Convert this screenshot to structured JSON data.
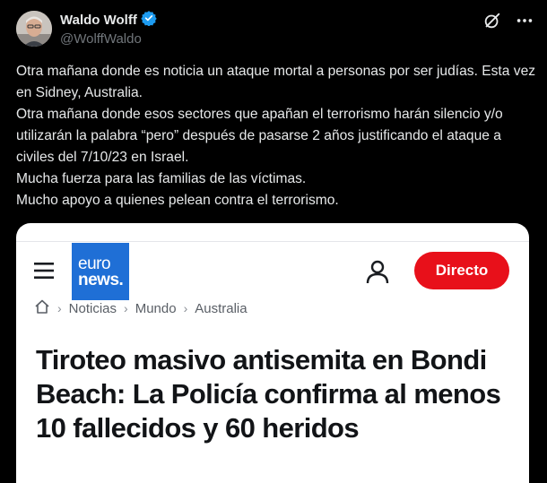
{
  "author": {
    "name": "Waldo Wolff",
    "handle": "@WolffWaldo"
  },
  "tweet": {
    "lines": [
      "Otra mañana donde es noticia un ataque mortal a personas por ser judías. Esta vez en Sidney, Australia.",
      "Otra mañana donde esos sectores que apañan el terrorismo harán silencio y/o utilizarán la palabra “pero” después de pasarse 2 años justificando el ataque a civiles del 7/10/23 en Israel.",
      "Mucha fuerza para las familias de las víctimas.",
      "Mucho apoyo a quienes pelean contra el terrorismo."
    ]
  },
  "card": {
    "logo_line1": "euro",
    "logo_line2": "news.",
    "live_button": "Directo",
    "breadcrumb": [
      "Noticias",
      "Mundo",
      "Australia"
    ],
    "headline": "Tiroteo masivo antisemita en Bondi Beach: La Policía confirma al menos 10 fallecidos y 60 heridos"
  },
  "colors": {
    "verified_badge": "#1d9bf0",
    "brand_blue": "#1f6fd6",
    "live_red": "#e8101a"
  },
  "icons": [
    "verified-badge-icon",
    "grok-icon",
    "more-icon",
    "menu-icon",
    "user-icon",
    "home-icon"
  ]
}
